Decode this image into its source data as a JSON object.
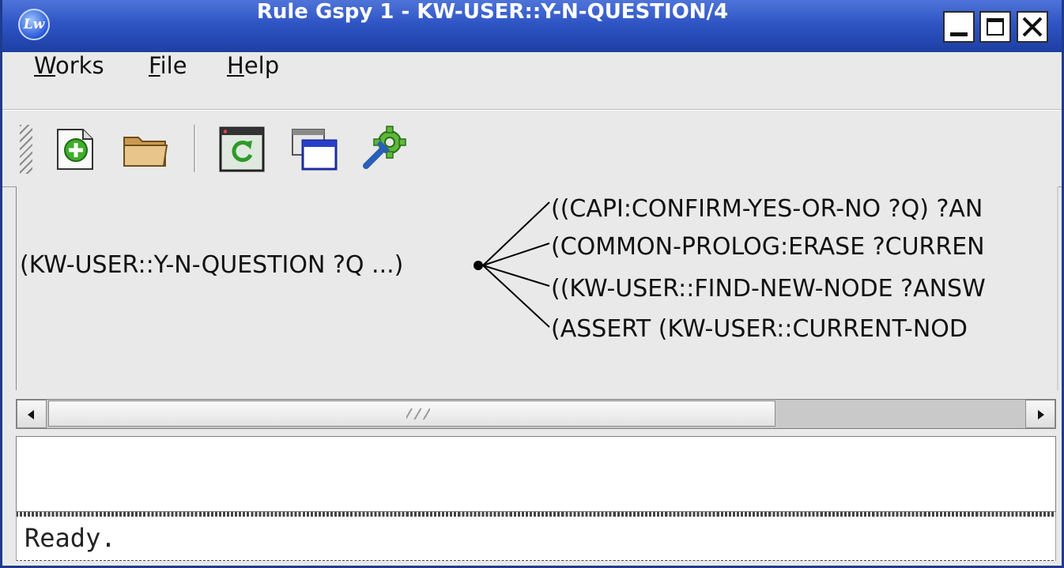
{
  "window": {
    "title": "Rule Gspy 1 - KW-USER::Y-N-QUESTION/4",
    "app_icon_text": "Lw",
    "controls": [
      "minimize-icon",
      "maximize-icon",
      "close-icon"
    ]
  },
  "menu": {
    "works": {
      "mnemonic": "W",
      "rest": "orks"
    },
    "file": {
      "mnemonic": "F",
      "rest": "ile"
    },
    "help": {
      "mnemonic": "H",
      "rest": "elp"
    }
  },
  "toolbar": {
    "icons": [
      "new-document-icon",
      "open-folder-icon",
      "refresh-window-icon",
      "windows-icon",
      "settings-icon"
    ]
  },
  "graph": {
    "root": "(KW-USER::Y-N-QUESTION ?Q ...)",
    "children": [
      "((CAPI:CONFIRM-YES-OR-NO ?Q) ?AN",
      "(COMMON-PROLOG:ERASE ?CURREN",
      "((KW-USER::FIND-NEW-NODE ?ANSW",
      "(ASSERT (KW-USER::CURRENT-NOD"
    ]
  },
  "status": {
    "text": "Ready."
  },
  "colors": {
    "title_bar": "#2f55c5",
    "window_bg": "#e9e9e9",
    "accent_green": "#3fae2a"
  }
}
